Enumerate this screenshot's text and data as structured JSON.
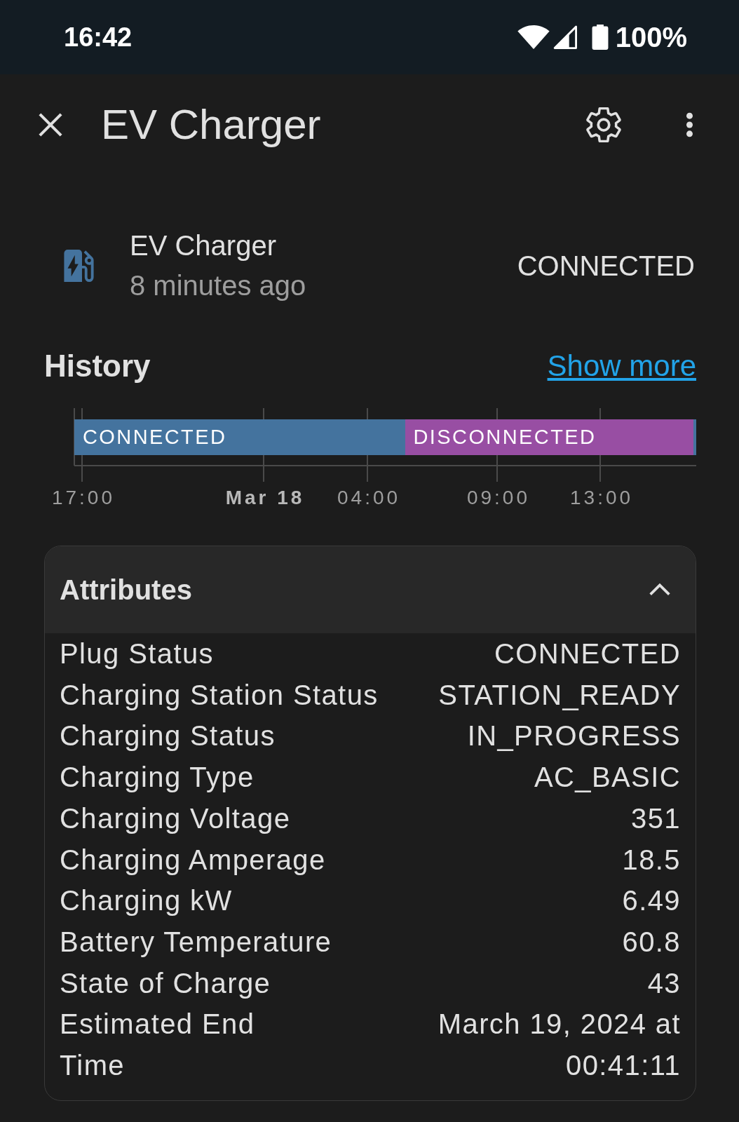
{
  "status_bar": {
    "time": "16:42",
    "battery": "100%"
  },
  "header": {
    "title": "EV Charger"
  },
  "entity": {
    "name": "EV Charger",
    "last_changed": "8 minutes ago",
    "state": "CONNECTED"
  },
  "history": {
    "title": "History",
    "link": "Show more",
    "timeline": {
      "segments": [
        {
          "label": "CONNECTED",
          "color": "#44739e",
          "level": 0.5316
        },
        {
          "label": "DISCONNECTED",
          "color": "#984ea3",
          "level": 0.4639
        },
        {
          "color": "#44739e",
          "level": 0.0045
        }
      ],
      "axis_labels": [
        {
          "label": "17:00",
          "bold": false
        },
        {
          "label": "Mar 18",
          "bold": true
        },
        {
          "label": "04:00",
          "bold": false
        },
        {
          "label": "09:00",
          "bold": false
        },
        {
          "label": "13:00",
          "bold": false
        }
      ]
    }
  },
  "attributes": {
    "title": "Attributes",
    "expanded": true,
    "rows": [
      {
        "label": "Plug Status",
        "value": "CONNECTED"
      },
      {
        "label": "Charging Station Status",
        "value": "STATION_READY"
      },
      {
        "label": "Charging Status",
        "value": "IN_PROGRESS"
      },
      {
        "label": "Charging Type",
        "value": "AC_BASIC"
      },
      {
        "label": "Charging Voltage",
        "value": "351"
      },
      {
        "label": "Charging Amperage",
        "value": "18.5"
      },
      {
        "label": "Charging kW",
        "value": "6.49"
      },
      {
        "label": "Battery Temperature",
        "value": "60.8"
      },
      {
        "label": "State of Charge",
        "value": "43"
      },
      {
        "label": "Estimated End Time",
        "value": "March 19, 2024 at 00:41:11"
      }
    ]
  }
}
